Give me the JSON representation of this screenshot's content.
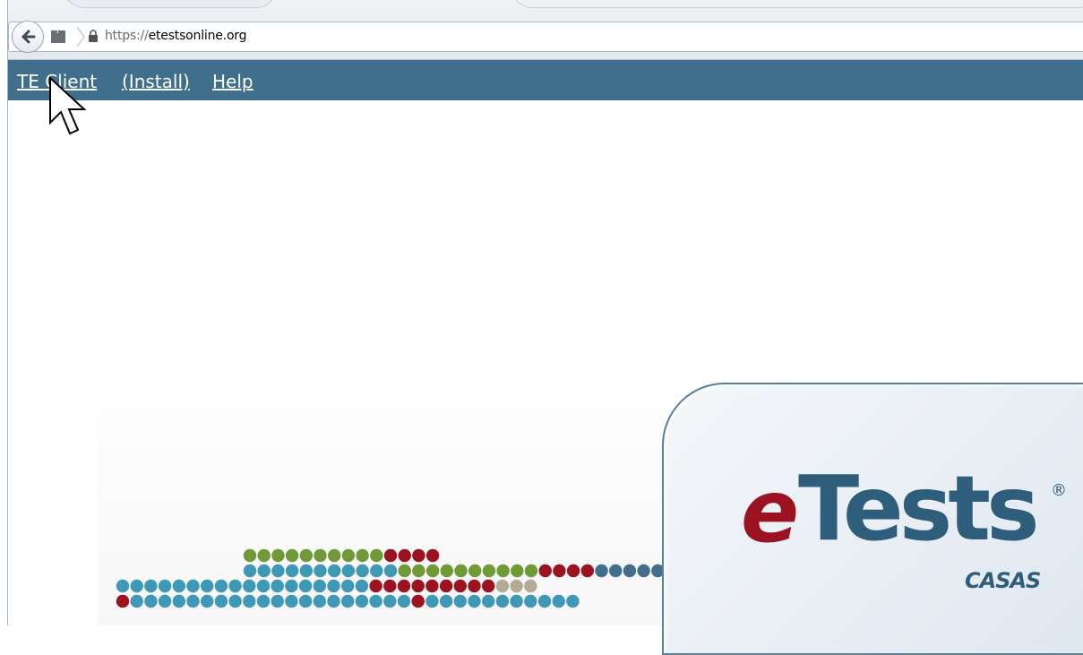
{
  "browser": {
    "url_scheme": "https://",
    "url_host": "etestsonline.org"
  },
  "nav": {
    "links": [
      {
        "label": "TE Client"
      },
      {
        "label": "(Install)"
      },
      {
        "label": "Help"
      }
    ]
  },
  "logo": {
    "e": "e",
    "tests": "Tests",
    "registered": "®",
    "casas": "CASAS"
  },
  "colors": {
    "navbar": "#3f6f8d",
    "logo_red": "#9b1220",
    "logo_blue": "#2f5e7c",
    "dot_teal": "#3f98b6",
    "dot_green": "#6f9a36",
    "dot_red": "#9b1220",
    "dot_tan": "#b4ab96",
    "dot_navy": "#3f6f8d"
  }
}
